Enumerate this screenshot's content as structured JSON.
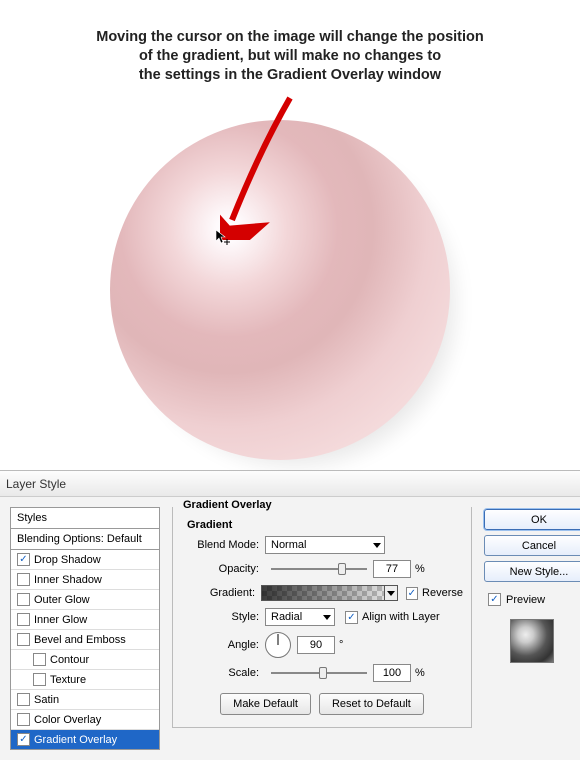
{
  "illustration": {
    "caption_line1": "Moving the cursor on the image will change the position",
    "caption_line2": "of the gradient, but will make no changes to",
    "caption_line3": "the settings in the Gradient Overlay window"
  },
  "dialog": {
    "title": "Layer Style",
    "styles_header": "Styles",
    "blending_header": "Blending Options: Default",
    "effects": [
      {
        "label": "Drop Shadow",
        "checked": true,
        "indent": false,
        "active": false
      },
      {
        "label": "Inner Shadow",
        "checked": false,
        "indent": false,
        "active": false
      },
      {
        "label": "Outer Glow",
        "checked": false,
        "indent": false,
        "active": false
      },
      {
        "label": "Inner Glow",
        "checked": false,
        "indent": false,
        "active": false
      },
      {
        "label": "Bevel and Emboss",
        "checked": false,
        "indent": false,
        "active": false
      },
      {
        "label": "Contour",
        "checked": false,
        "indent": true,
        "active": false
      },
      {
        "label": "Texture",
        "checked": false,
        "indent": true,
        "active": false
      },
      {
        "label": "Satin",
        "checked": false,
        "indent": false,
        "active": false
      },
      {
        "label": "Color Overlay",
        "checked": false,
        "indent": false,
        "active": false
      },
      {
        "label": "Gradient Overlay",
        "checked": true,
        "indent": false,
        "active": true
      }
    ]
  },
  "gradientOverlay": {
    "group_title": "Gradient Overlay",
    "subgroup_title": "Gradient",
    "labels": {
      "blend_mode": "Blend Mode:",
      "opacity": "Opacity:",
      "gradient": "Gradient:",
      "style": "Style:",
      "angle": "Angle:",
      "scale": "Scale:"
    },
    "blend_mode": "Normal",
    "opacity": "77",
    "opacity_unit": "%",
    "reverse_checked": true,
    "reverse_label": "Reverse",
    "style": "Radial",
    "align_checked": true,
    "align_label": "Align with Layer",
    "angle": "90",
    "angle_unit": "°",
    "scale": "100",
    "scale_unit": "%",
    "make_default": "Make Default",
    "reset_default": "Reset to Default"
  },
  "right": {
    "ok": "OK",
    "cancel": "Cancel",
    "new_style": "New Style...",
    "preview_checked": true,
    "preview_label": "Preview"
  }
}
